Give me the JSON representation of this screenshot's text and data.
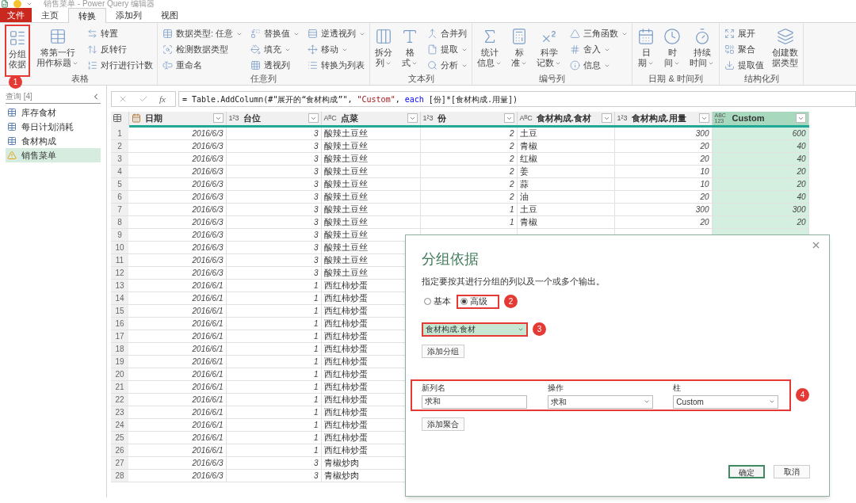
{
  "window": {
    "title": "销售菜单 - Power Query 编辑器"
  },
  "tabs": [
    {
      "label": "文件",
      "kind": "file",
      "selected": false
    },
    {
      "label": "主页",
      "kind": "tab",
      "selected": false
    },
    {
      "label": "转换",
      "kind": "tab",
      "selected": true
    },
    {
      "label": "添加列",
      "kind": "tab",
      "selected": false
    },
    {
      "label": "视图",
      "kind": "tab",
      "selected": false
    }
  ],
  "ribbon": {
    "groups": [
      {
        "label": "表格",
        "items": [
          {
            "kind": "large",
            "lines": [
              "分组",
              "依据"
            ],
            "dropdown": false,
            "callout": "1"
          },
          {
            "kind": "large",
            "lines": [
              "将第一行",
              "用作标题"
            ],
            "dropdown": true
          },
          {
            "kind": "stack",
            "items": [
              {
                "label": "转置",
                "dropdown": false
              },
              {
                "label": "反转行",
                "dropdown": false
              },
              {
                "label": "对行进行计数",
                "dropdown": false
              }
            ]
          }
        ]
      },
      {
        "label": "任意列",
        "items": [
          {
            "kind": "stack",
            "items": [
              {
                "label": "数据类型: 任意",
                "dropdown": true
              },
              {
                "label": "检测数据类型",
                "dropdown": false
              },
              {
                "label": "重命名",
                "dropdown": false
              }
            ]
          },
          {
            "kind": "stack",
            "items": [
              {
                "label": "替换值",
                "dropdown": true
              },
              {
                "label": "填充",
                "dropdown": true
              },
              {
                "label": "透视列",
                "dropdown": false
              }
            ]
          },
          {
            "kind": "stack",
            "items": [
              {
                "label": "逆透视列",
                "dropdown": true
              },
              {
                "label": "移动",
                "dropdown": true
              },
              {
                "label": "转换为列表",
                "dropdown": false
              }
            ]
          }
        ]
      },
      {
        "label": "文本列",
        "items": [
          {
            "kind": "large",
            "lines": [
              "拆分",
              "列"
            ],
            "dropdown": true
          },
          {
            "kind": "large",
            "lines": [
              "格",
              "式"
            ],
            "dropdown": true
          },
          {
            "kind": "stack",
            "items": [
              {
                "label": "合并列",
                "dropdown": false
              },
              {
                "label": "提取",
                "dropdown": true
              },
              {
                "label": "分析",
                "dropdown": true
              }
            ]
          }
        ]
      },
      {
        "label": "编号列",
        "items": [
          {
            "kind": "large",
            "lines": [
              "统计",
              "信息"
            ],
            "dropdown": true
          },
          {
            "kind": "large",
            "lines": [
              "标",
              "准"
            ],
            "dropdown": true
          },
          {
            "kind": "large",
            "lines": [
              "科学",
              "记数"
            ],
            "dropdown": true
          },
          {
            "kind": "stack",
            "items": [
              {
                "label": "三角函数",
                "dropdown": true
              },
              {
                "label": "舍入",
                "dropdown": true
              },
              {
                "label": "信息",
                "dropdown": true
              }
            ]
          }
        ]
      },
      {
        "label": "日期 & 时间列",
        "items": [
          {
            "kind": "large",
            "lines": [
              "日",
              "期"
            ],
            "dropdown": true
          },
          {
            "kind": "large",
            "lines": [
              "时",
              "间"
            ],
            "dropdown": true
          },
          {
            "kind": "large",
            "lines": [
              "持续",
              "时间"
            ],
            "dropdown": true
          }
        ]
      },
      {
        "label": "结构化列",
        "items": [
          {
            "kind": "stack",
            "items": [
              {
                "label": "展开",
                "dropdown": false
              },
              {
                "label": "聚合",
                "dropdown": false
              },
              {
                "label": "提取值",
                "dropdown": false
              }
            ]
          },
          {
            "kind": "large",
            "lines": [
              "创建数",
              "据类型"
            ],
            "dropdown": false
          }
        ]
      }
    ]
  },
  "queries": {
    "title": "查询 [4]",
    "items": [
      {
        "label": "库存食材",
        "kind": "table",
        "selected": false
      },
      {
        "label": "每日计划消耗",
        "kind": "table",
        "selected": false
      },
      {
        "label": "食材构成",
        "kind": "table",
        "selected": false
      },
      {
        "label": "销售菜单",
        "kind": "warning",
        "selected": true
      }
    ]
  },
  "formula_bar": {
    "fx": "fx",
    "tokens": [
      {
        "text": "= Table.AddColumn(#\"展开的“食材构成”\", ",
        "kind": "plain"
      },
      {
        "text": "\"Custom\"",
        "kind": "string"
      },
      {
        "text": ", ",
        "kind": "plain"
      },
      {
        "text": "each",
        "kind": "keyword"
      },
      {
        "text": " [份]*[食材构成.用量])",
        "kind": "plain"
      }
    ]
  },
  "table": {
    "columns": [
      {
        "name": "日期",
        "kind": "date",
        "selected": false
      },
      {
        "name": "台位",
        "kind": "number",
        "type_label": "1²3",
        "selected": false
      },
      {
        "name": "点菜",
        "kind": "text",
        "type_label": "AᴮC",
        "selected": false
      },
      {
        "name": "份",
        "kind": "number",
        "type_label": "1²3",
        "selected": false
      },
      {
        "name": "食材构成.食材",
        "kind": "text",
        "type_label": "AᴮC",
        "selected": false
      },
      {
        "name": "食材构成.用量",
        "kind": "number",
        "type_label": "1²3",
        "selected": false
      },
      {
        "name": "Custom",
        "kind": "number",
        "type_label": "ABC 123",
        "selected": true
      }
    ],
    "rows": [
      {
        "number": "1",
        "cells": [
          "2016/6/3",
          "3",
          "酸辣土豆丝",
          "2",
          "土豆",
          "300",
          "600"
        ]
      },
      {
        "number": "2",
        "cells": [
          "2016/6/3",
          "3",
          "酸辣土豆丝",
          "2",
          "青椒",
          "20",
          "40"
        ]
      },
      {
        "number": "3",
        "cells": [
          "2016/6/3",
          "3",
          "酸辣土豆丝",
          "2",
          "红椒",
          "20",
          "40"
        ]
      },
      {
        "number": "4",
        "cells": [
          "2016/6/3",
          "3",
          "酸辣土豆丝",
          "2",
          "姜",
          "10",
          "20"
        ]
      },
      {
        "number": "5",
        "cells": [
          "2016/6/3",
          "3",
          "酸辣土豆丝",
          "2",
          "蒜",
          "10",
          "20"
        ]
      },
      {
        "number": "6",
        "cells": [
          "2016/6/3",
          "3",
          "酸辣土豆丝",
          "2",
          "油",
          "20",
          "40"
        ]
      },
      {
        "number": "7",
        "cells": [
          "2016/6/3",
          "3",
          "酸辣土豆丝",
          "1",
          "土豆",
          "300",
          "300"
        ]
      },
      {
        "number": "8",
        "cells": [
          "2016/6/3",
          "3",
          "酸辣土豆丝",
          "1",
          "青椒",
          "20",
          "20"
        ]
      },
      {
        "number": "9",
        "cells": [
          "2016/6/3",
          "3",
          "酸辣土豆丝"
        ]
      },
      {
        "number": "10",
        "cells": [
          "2016/6/3",
          "3",
          "酸辣土豆丝"
        ]
      },
      {
        "number": "11",
        "cells": [
          "2016/6/3",
          "3",
          "酸辣土豆丝"
        ]
      },
      {
        "number": "12",
        "cells": [
          "2016/6/3",
          "3",
          "酸辣土豆丝"
        ]
      },
      {
        "number": "13",
        "cells": [
          "2016/6/1",
          "1",
          "西红柿炒蛋"
        ]
      },
      {
        "number": "14",
        "cells": [
          "2016/6/1",
          "1",
          "西红柿炒蛋"
        ]
      },
      {
        "number": "15",
        "cells": [
          "2016/6/1",
          "1",
          "西红柿炒蛋"
        ]
      },
      {
        "number": "16",
        "cells": [
          "2016/6/1",
          "1",
          "西红柿炒蛋"
        ]
      },
      {
        "number": "17",
        "cells": [
          "2016/6/1",
          "1",
          "西红柿炒蛋"
        ]
      },
      {
        "number": "18",
        "cells": [
          "2016/6/1",
          "1",
          "西红柿炒蛋"
        ]
      },
      {
        "number": "19",
        "cells": [
          "2016/6/1",
          "1",
          "西红柿炒蛋"
        ]
      },
      {
        "number": "20",
        "cells": [
          "2016/6/1",
          "1",
          "西红柿炒蛋"
        ]
      },
      {
        "number": "21",
        "cells": [
          "2016/6/1",
          "1",
          "西红柿炒蛋"
        ]
      },
      {
        "number": "22",
        "cells": [
          "2016/6/1",
          "1",
          "西红柿炒蛋"
        ]
      },
      {
        "number": "23",
        "cells": [
          "2016/6/1",
          "1",
          "西红柿炒蛋"
        ]
      },
      {
        "number": "24",
        "cells": [
          "2016/6/1",
          "1",
          "西红柿炒蛋"
        ]
      },
      {
        "number": "25",
        "cells": [
          "2016/6/1",
          "1",
          "西红柿炒蛋"
        ]
      },
      {
        "number": "26",
        "cells": [
          "2016/6/1",
          "1",
          "西红柿炒蛋"
        ]
      },
      {
        "number": "27",
        "cells": [
          "2016/6/3",
          "3",
          "青椒炒肉"
        ]
      },
      {
        "number": "28",
        "cells": [
          "2016/6/3",
          "3",
          "青椒炒肉"
        ]
      }
    ]
  },
  "dialog": {
    "title": "分组依据",
    "description": "指定要按其进行分组的列以及一个或多个输出。",
    "modes": [
      {
        "label": "基本",
        "selected": false
      },
      {
        "label": "高级",
        "selected": true,
        "callout": "2"
      }
    ],
    "groupings": [
      {
        "value": "食材构成.食材",
        "selected": true,
        "callout": "3"
      }
    ],
    "add_grouping": "添加分组",
    "aggregation_callout": "4",
    "aggregations": [
      {
        "label": "新列名",
        "kind": "input",
        "value": "求和"
      },
      {
        "label": "操作",
        "kind": "select",
        "value": "求和"
      },
      {
        "label": "柱",
        "kind": "select",
        "value": "Custom"
      }
    ],
    "add_aggregation": "添加聚合",
    "buttons": [
      {
        "label": "确定",
        "kind": "primary"
      },
      {
        "label": "取消",
        "kind": "secondary"
      }
    ]
  }
}
